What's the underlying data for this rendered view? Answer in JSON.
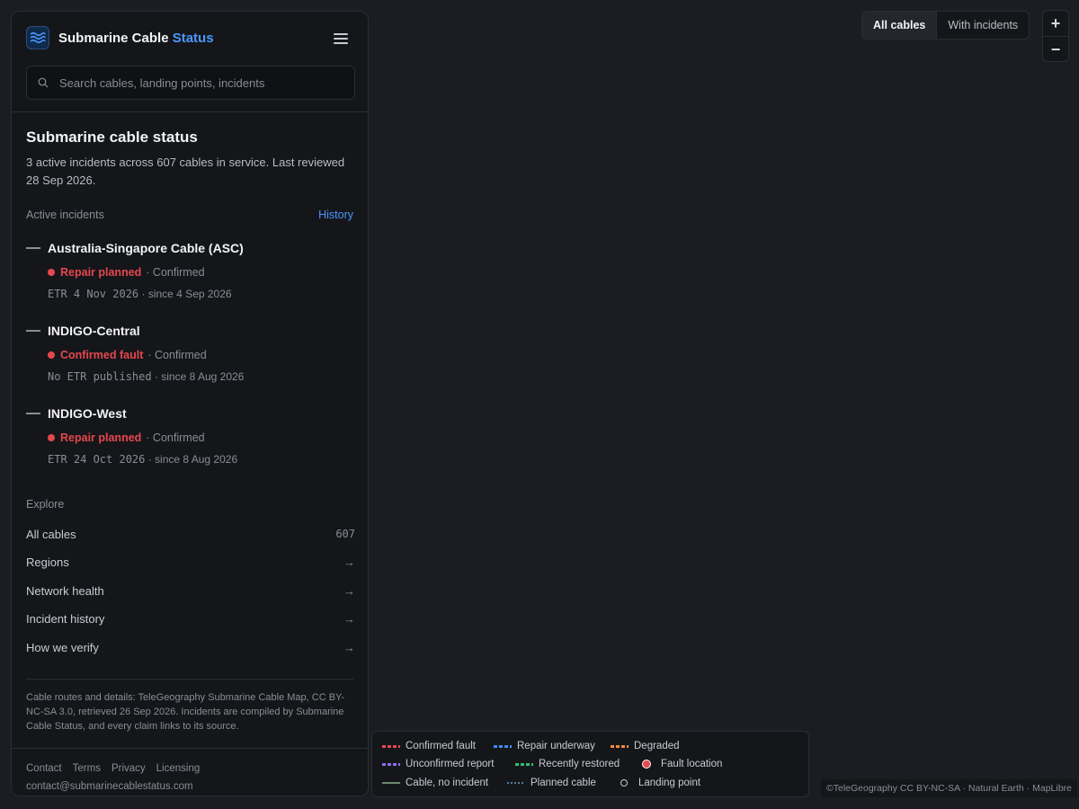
{
  "app": {
    "name": "Submarine Cable",
    "name_accent": "Status"
  },
  "search": {
    "placeholder": "Search cables, landing points, incidents"
  },
  "overview": {
    "title": "Submarine cable status",
    "summary": "3 active incidents across 607 cables in service. Last reviewed 28 Sep 2026."
  },
  "incidents": {
    "label": "Active incidents",
    "history_link": "History",
    "items": [
      {
        "name": "Australia-Singapore Cable (ASC)",
        "status": "Repair planned",
        "confirmation": "· Confirmed",
        "etr": "ETR 4 Nov 2026",
        "since": "· since 4 Sep 2026"
      },
      {
        "name": "INDIGO-Central",
        "status": "Confirmed fault",
        "confirmation": "· Confirmed",
        "etr": "No ETR published",
        "since": "· since 8 Aug 2026"
      },
      {
        "name": "INDIGO-West",
        "status": "Repair planned",
        "confirmation": "· Confirmed",
        "etr": "ETR 24 Oct 2026",
        "since": "· since 8 Aug 2026"
      }
    ]
  },
  "explore": {
    "label": "Explore",
    "items": [
      {
        "label": "All cables",
        "count": "607"
      },
      {
        "label": "Regions",
        "arrow": "→"
      },
      {
        "label": "Network health",
        "arrow": "→"
      },
      {
        "label": "Incident history",
        "arrow": "→"
      },
      {
        "label": "How we verify",
        "arrow": "→"
      }
    ]
  },
  "credits": "Cable routes and details: TeleGeography Submarine Cable Map, CC BY-NC-SA 3.0, retrieved 26 Sep 2026. Incidents are compiled by Submarine Cable Status, and every claim links to its source.",
  "footer": {
    "links": [
      "Contact",
      "Terms",
      "Privacy",
      "Licensing"
    ],
    "email": "contact@submarinecablestatus.com"
  },
  "map_toggle": {
    "all": "All cables",
    "incidents": "With incidents",
    "selected": "All cables"
  },
  "zoom": {
    "in": "+",
    "out": "−"
  },
  "legend": {
    "items": [
      {
        "label": "Confirmed fault",
        "color": "#e5484d",
        "style": "dashed"
      },
      {
        "label": "Repair underway",
        "color": "#3e8cf0",
        "style": "dashed"
      },
      {
        "label": "Degraded",
        "color": "#f08a3e",
        "style": "dashed"
      },
      {
        "label": "Unconfirmed report",
        "color": "#8e6cf0",
        "style": "dashed"
      },
      {
        "label": "Recently restored",
        "color": "#2fbf71",
        "style": "dashed"
      },
      {
        "label": "Fault location",
        "color": "#e5484d",
        "style": "dot"
      },
      {
        "label": "Cable, no incident",
        "color": "#6b8a6b",
        "style": "solid"
      },
      {
        "label": "Planned cable",
        "color": "#5a7a99",
        "style": "dotted"
      },
      {
        "label": "Landing point",
        "color": "#c9cbd1",
        "style": "ring"
      }
    ]
  },
  "attribution": "©TeleGeography CC BY-NC-SA · Natural Earth · MapLibre",
  "colors": {
    "accent": "#4c97ff",
    "fault": "#e5484d",
    "background": "#1c1d22",
    "panel": "#15161a"
  }
}
